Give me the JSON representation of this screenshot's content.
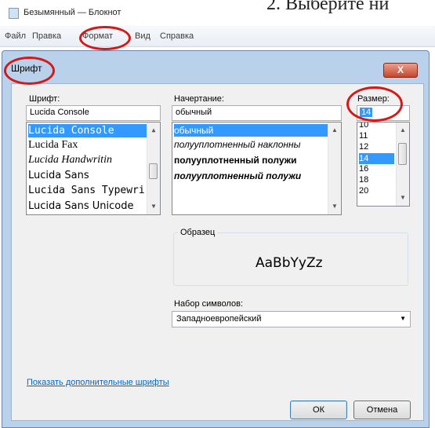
{
  "window": {
    "title": "Безымянный — Блокнот"
  },
  "overlay_text": "2. Выберите ни",
  "menu": {
    "items": [
      "Файл",
      "Правка",
      "Формат",
      "Вид",
      "Справка"
    ]
  },
  "dialog": {
    "title": "Шрифт",
    "close_label": "X"
  },
  "font": {
    "label": "Шрифт:",
    "value": "Lucida Console",
    "items": [
      "Lucida Console",
      "Lucida Fax",
      "Lucida Handwritin",
      "Lucida Sans",
      "Lucida Sans Typewri",
      "Lucida Sans Unicode"
    ],
    "selected_index": 0
  },
  "style": {
    "label": "Начертание:",
    "value": "обычный",
    "items": [
      "обычный",
      "полууплотненный наклонны",
      "полууплотненный полужи",
      "полууплотненный полужи"
    ],
    "selected_index": 0
  },
  "size": {
    "label": "Размер:",
    "value": "14",
    "items": [
      "10",
      "11",
      "12",
      "14",
      "16",
      "18",
      "20"
    ],
    "selected_index": 3
  },
  "sample": {
    "label": "Образец",
    "text": "AaBbYyZz"
  },
  "charset": {
    "label": "Набор символов:",
    "value": "Западноевропейский"
  },
  "more_fonts_link": "Показать дополнительные шрифты",
  "buttons": {
    "ok": "ОК",
    "cancel": "Отмена"
  },
  "colors": {
    "annotation_circle": "#d11a1a",
    "selection": "#3399ff",
    "link": "#0066cc"
  }
}
